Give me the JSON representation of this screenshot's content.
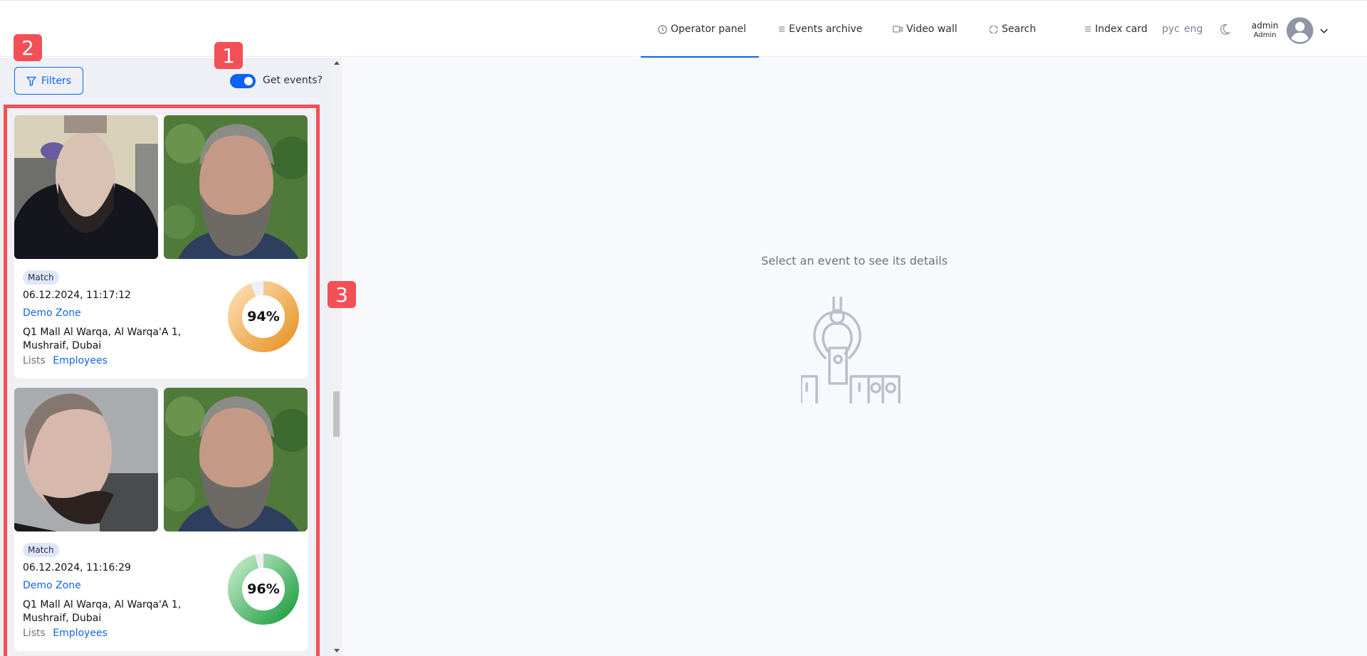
{
  "nav": {
    "items": [
      {
        "label": "Operator panel",
        "icon": "clock-icon",
        "active": true
      },
      {
        "label": "Events archive",
        "icon": "list-icon",
        "active": false
      },
      {
        "label": "Video wall",
        "icon": "video-camera-icon",
        "active": false
      },
      {
        "label": "Search",
        "icon": "search-target-icon",
        "active": false
      },
      {
        "label": "Index card",
        "icon": "list-icon",
        "active": false
      }
    ],
    "languages": [
      "рус",
      "eng"
    ],
    "theme_icon": "moon-icon",
    "user": {
      "name": "admin",
      "role": "Admin"
    }
  },
  "left_panel": {
    "filters_label": "Filters",
    "toggle_label": "Get events?",
    "toggle_on": true,
    "events": [
      {
        "badge": "Match",
        "datetime": "06.12.2024, 11:17:12",
        "zone": "Demo Zone",
        "address": "Q1 Mall Al Warqa, Al Warqa'A 1, Mushraif, Dubai",
        "lists_label": "Lists",
        "list_value": "Employees",
        "score_percent": 94,
        "score_text": "94%",
        "score_color": "#e8962a"
      },
      {
        "badge": "Match",
        "datetime": "06.12.2024, 11:16:29",
        "zone": "Demo Zone",
        "address": "Q1 Mall Al Warqa, Al Warqa'A 1, Mushraif, Dubai",
        "lists_label": "Lists",
        "list_value": "Employees",
        "score_percent": 96,
        "score_text": "96%",
        "score_color": "#2eaa4a"
      }
    ]
  },
  "main": {
    "empty_message": "Select an event to see its details"
  },
  "annotations": [
    "1",
    "2",
    "3"
  ],
  "colors": {
    "accent": "#0b62f5",
    "annotation": "#f25056"
  }
}
